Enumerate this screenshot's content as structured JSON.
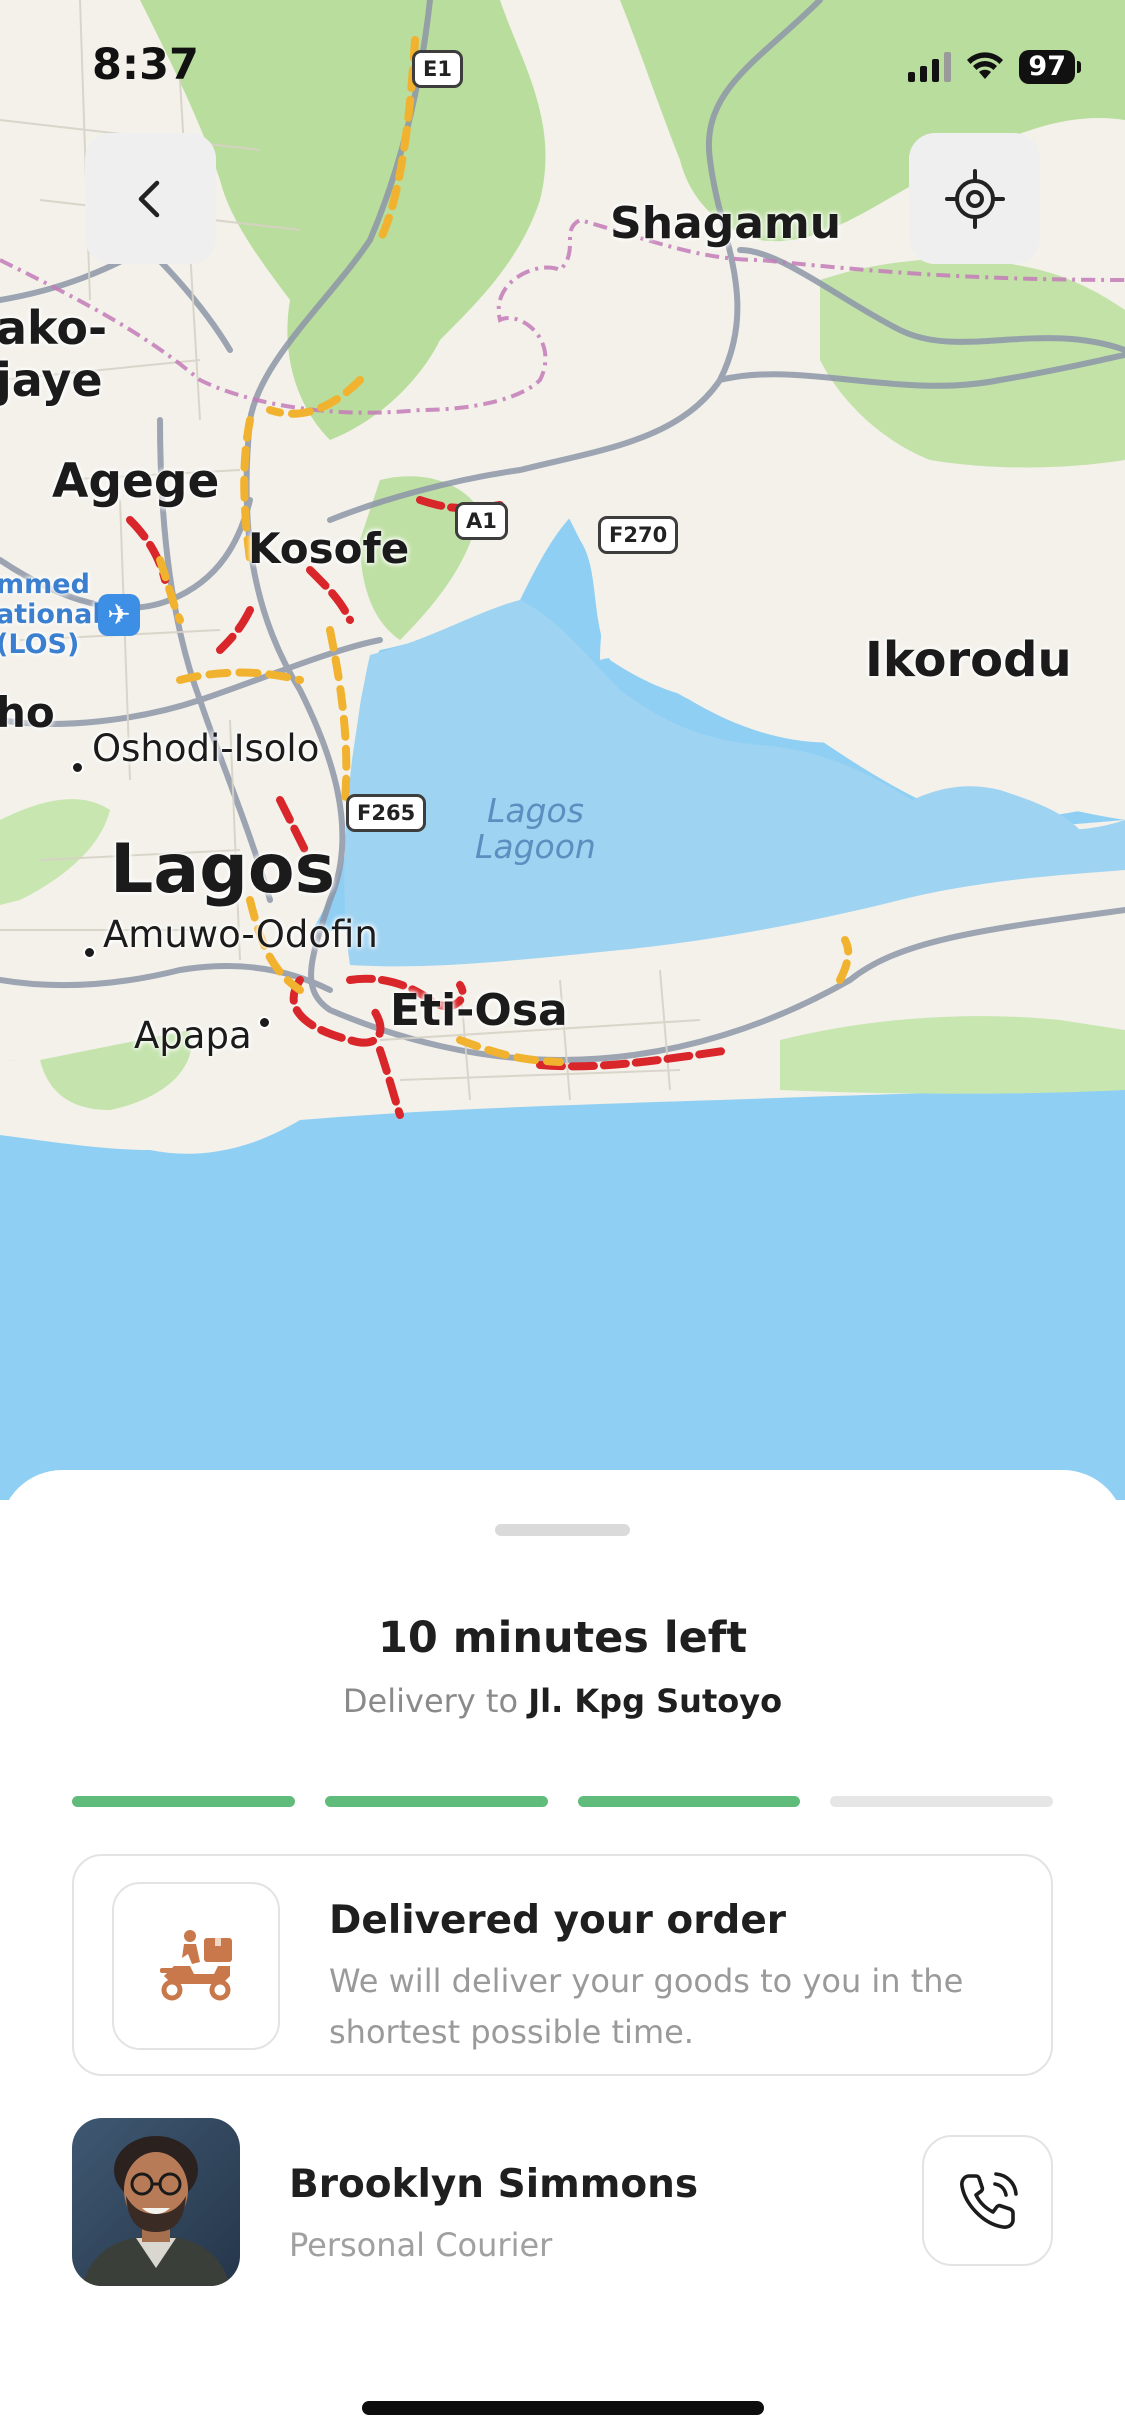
{
  "status_bar": {
    "time": "8:37",
    "battery": "97"
  },
  "map": {
    "labels": {
      "shagamu": "Shagamu",
      "ikorodu": "Ikorodu",
      "agege": "Agege",
      "kosofe": "Kosofe",
      "lagos": "Lagos",
      "oshodi": "Oshodi-Isolo",
      "amuwo": "Amuwo-Odofin",
      "apapa": "Apapa",
      "etiosa": "Eti-Osa",
      "lagoon": "Lagos\nLagoon",
      "ako": "ako-\njaye",
      "ho": "ho",
      "airport": "mmed\national\n(LOS)"
    },
    "shields": {
      "e1": "E1",
      "a1": "A1",
      "f270": "F270",
      "f265": "F265"
    }
  },
  "sheet": {
    "eta_title": "10 minutes left",
    "eta_prefix": "Delivery to",
    "eta_address": "Jl. Kpg Sutoyo",
    "progress": {
      "completed_steps": 3,
      "total_steps": 4
    },
    "status_card": {
      "title": "Delivered your order",
      "description": "We will deliver your goods to you in the shortest possible time.",
      "icon": "delivery-scooter-icon"
    },
    "courier": {
      "name": "Brooklyn Simmons",
      "role": "Personal Courier"
    }
  },
  "colors": {
    "progress_done": "#5fbc7b",
    "progress_pending": "#e6e6e6",
    "accent_icon": "#c8784a",
    "water": "#8ccdf3",
    "land": "#f3f1ea",
    "park": "#b7dc9a",
    "traffic_heavy": "#d9262b",
    "traffic_moderate": "#f1b32f"
  }
}
